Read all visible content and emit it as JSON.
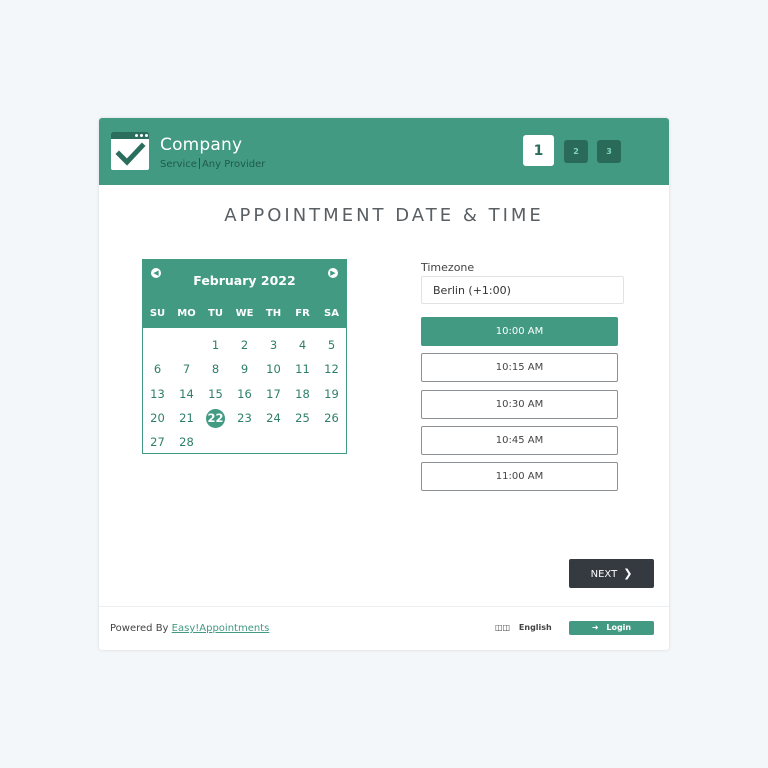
{
  "colors": {
    "brand": "#429a82",
    "brand_dark": "#2c6e5d",
    "dark_button": "#343a40",
    "page_bg": "#f4f7fa"
  },
  "header": {
    "logo_icon": "calendar-check-icon",
    "company_name": "Company",
    "service": "Service",
    "provider": "Any Provider",
    "steps": [
      {
        "label": "1",
        "active": true
      },
      {
        "label": "2",
        "active": false
      },
      {
        "label": "3",
        "active": false
      }
    ]
  },
  "main": {
    "title": "APPOINTMENT DATE & TIME"
  },
  "calendar": {
    "prev_icon": "chevron-left-icon",
    "next_icon": "chevron-right-icon",
    "month_label": "February 2022",
    "weekdays": [
      "SU",
      "MO",
      "TU",
      "WE",
      "TH",
      "FR",
      "SA"
    ],
    "first_weekday_index": 2,
    "days_in_month": 28,
    "selected_day": 22
  },
  "timezone": {
    "label": "Timezone",
    "value": "Berlin (+1:00)"
  },
  "slots": [
    {
      "label": "10:00 AM",
      "selected": true
    },
    {
      "label": "10:15 AM",
      "selected": false
    },
    {
      "label": "10:30 AM",
      "selected": false
    },
    {
      "label": "10:45 AM",
      "selected": false
    },
    {
      "label": "11:00 AM",
      "selected": false
    }
  ],
  "actions": {
    "next_label": "NEXT",
    "next_icon": "chevron-right-icon"
  },
  "footer": {
    "powered_by": "Powered By",
    "powered_link": "Easy!Appointments",
    "language_icon": "language-icon",
    "language": "English",
    "login_icon": "sign-in-icon",
    "login_label": "Login"
  }
}
